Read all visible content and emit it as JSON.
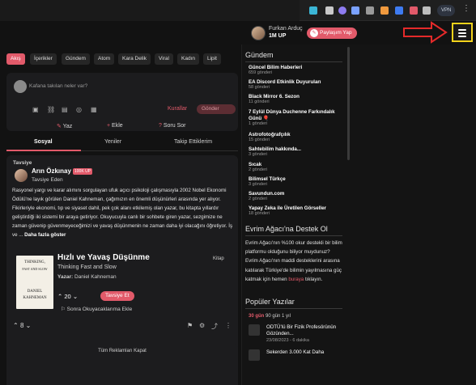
{
  "browser": {
    "vpn_label": "VPN",
    "menu_glyph": "⋮",
    "extensions": [
      {
        "name": "ext-cyan-icon",
        "color": "#3bb6d6"
      },
      {
        "name": "ext-shield-icon",
        "color": "#c9c9c9"
      },
      {
        "name": "ext-purple-icon",
        "color": "#8e7cf1"
      },
      {
        "name": "ext-music-icon",
        "color": "#7aa1ff"
      },
      {
        "name": "ext-gray-icon",
        "color": "#9a9a9a"
      },
      {
        "name": "ext-orange-icon",
        "color": "#f19a3e"
      },
      {
        "name": "ext-blue-icon",
        "color": "#3e7bf1"
      },
      {
        "name": "ext-red-icon",
        "color": "#e25a6a"
      },
      {
        "name": "ext-puzzle-icon",
        "color": "#bdbdbd"
      }
    ]
  },
  "header": {
    "user_name": "Furkan Arduç",
    "user_points": "1M UP",
    "share_label": "Paylaşım Yap",
    "share_icon": "✎"
  },
  "tabs": [
    {
      "label": "Akış",
      "active": true
    },
    {
      "label": "İçerikler"
    },
    {
      "label": "Gündem"
    },
    {
      "label": "Atom"
    },
    {
      "label": "Kara Delik"
    },
    {
      "label": "Viral"
    },
    {
      "label": "Kadın"
    },
    {
      "label": "Lipit"
    }
  ],
  "composer": {
    "placeholder": "Kafana takılan neler var?",
    "tools": [
      "▣",
      "⛓",
      "▤",
      "◎",
      "▦"
    ],
    "rules_label": "Kurallar",
    "send_label": "Gönder",
    "actions": [
      {
        "icon": "✎",
        "label": "Yaz"
      },
      {
        "icon": "+",
        "label": "Ekle"
      },
      {
        "icon": "?",
        "label": "Soru Sor"
      }
    ]
  },
  "feed_tabs": [
    {
      "label": "Sosyal",
      "active": true
    },
    {
      "label": "Yeniler"
    },
    {
      "label": "Takip Ettiklerim"
    }
  ],
  "post": {
    "type_label": "Tavsiye",
    "author": "Arın Özkınay",
    "badge": "100K UP",
    "sub_label": "Tavsiye Eden",
    "body": "Rasyonel yargı ve karar alımını sorgulayan ufuk açıcı psikoloji çalışmasıyla 2002 Nobel Ekonomi Ödülü'ne layık görülen Daniel Kahneman, çağımızın en önemli düşünürleri arasında yer alıyor. Fikirleriyle ekonomi, tıp ve siyaset dahil, pek çok alanı etkilemiş olan yazar, bu kitapta yıllardır geliştirdiği iki sistemi bir araya getiriyor. Okuyucuyla canlı bir sohbete giren yazar, sezgimize ne zaman güvenip güvenmeyeceğimizi ve yavaş düşünmenin ne zaman daha iyi olacağını öğretiyor. İş ve ...",
    "more_label": "Daha fazla göster",
    "book": {
      "cover_title_1": "THINKING,",
      "cover_title_2": "FAST AND SLOW",
      "cover_author_1": "DANIEL",
      "cover_author_2": "KAHNEMAN",
      "title": "Hızlı ve Yavaş Düşünme",
      "kind": "Kitap",
      "english_title": "Thinking Fast and Slow",
      "author_label": "Yazar:",
      "author": "Daniel Kahneman",
      "votes": "20",
      "recommend_label": "Tavsiye Et",
      "read_later_label": "Sonra Okuyacaklarıma Ekle"
    },
    "votes": "8"
  },
  "ad": {
    "label": "Tüm Reklamları Kapat"
  },
  "right": {
    "gundem_title": "Gündem",
    "gundem": [
      {
        "title": "Güncel Bilim Haberleri",
        "count": "659 gönderi"
      },
      {
        "title": "EA Discord Etkinlik Duyuruları",
        "count": "58 gönderi"
      },
      {
        "title": "Black Mirror 6. Sezon",
        "count": "11 gönderi"
      },
      {
        "title": "7 Eylül Dünya Duchenne Farkındalık Günü 🎈",
        "count": "1 gönderi"
      },
      {
        "title": "Astrofotoğrafçılık",
        "count": "15 gönderi"
      },
      {
        "title": "Sahtebilim hakkında...",
        "count": "3 gönderi"
      },
      {
        "title": "Sıcak",
        "count": "2 gönderi"
      },
      {
        "title": "Bilimsel Türkçe",
        "count": "3 gönderi"
      },
      {
        "title": "Savundun.com",
        "count": "2 gönderi"
      },
      {
        "title": "Yapay Zeka ile Üretilen Görseller",
        "count": "18 gönderi"
      }
    ],
    "promo_title": "Evrim Ağacı'na Destek Ol",
    "promo_text": "Evrim Ağacı'nın %100 okur destekli bir bilim platformu olduğunu biliyor muydunuz? Evrim Ağacı'nın maddi desteklerini arasına katılarak Türkiye'de bilimin yayılmasına güç katmak için hemen",
    "promo_link": "buraya",
    "promo_end": "tıklayın.",
    "popular_title": "Popüler Yazılar",
    "filter_a": "30 gün",
    "filter_b": "90 gün  1 yıl",
    "popular": [
      {
        "title": "ODTÜ'lü Bir Fizik Profesörünün Gözünden...",
        "meta": "23/08/2023 - 6 dakika"
      },
      {
        "title": "Sekerden 3.000 Kat Daha",
        "meta": ""
      }
    ]
  }
}
